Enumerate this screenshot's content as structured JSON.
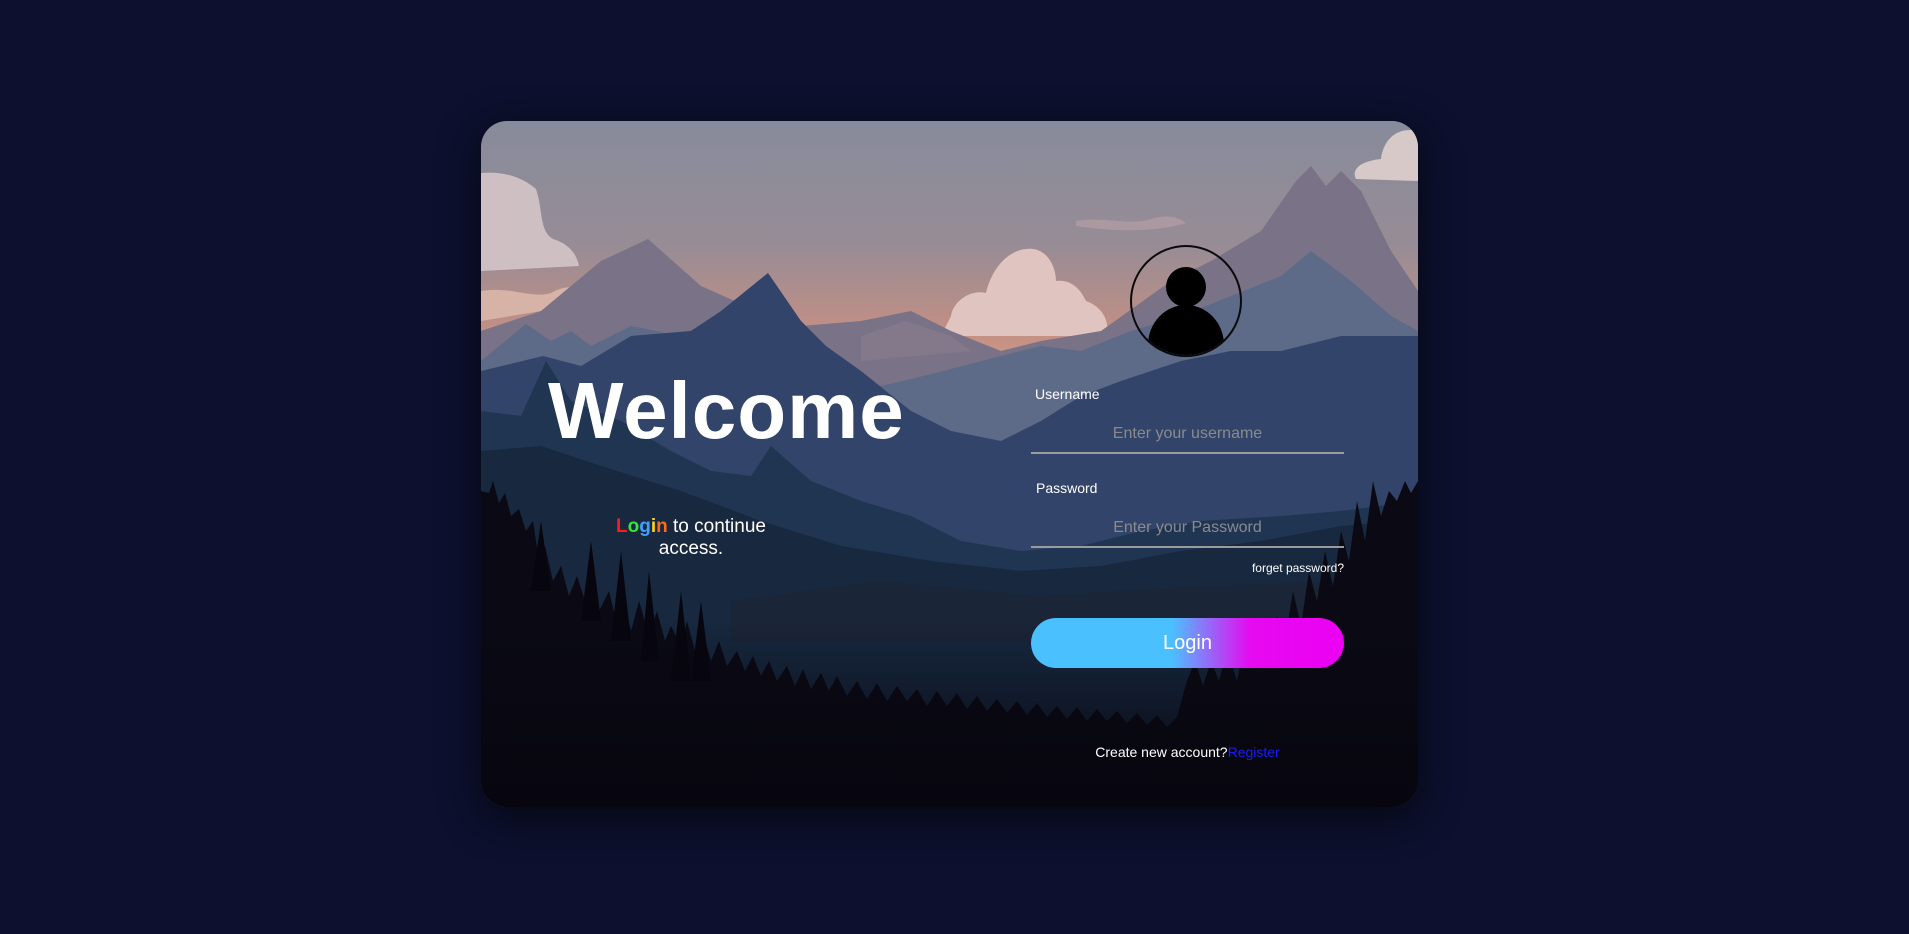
{
  "hero": {
    "title": "Welcome",
    "tagline_word": [
      "L",
      "o",
      "g",
      "i",
      "n"
    ],
    "tagline_rest": " to continue access."
  },
  "form": {
    "username_label": "Username",
    "username_placeholder": "Enter your username",
    "password_label": "Password",
    "password_placeholder": "Enter your Password",
    "forgot_text": "forget password?",
    "login_label": "Login",
    "create_text": "Create new account?",
    "register_text": "Register"
  },
  "colors": {
    "page_bg": "#0d102e",
    "button_start": "#4bc0ff",
    "button_end": "#ec00f3",
    "register_link": "#1a1aff",
    "tagline_letters": [
      "#ff1a1a",
      "#35e43a",
      "#3ea0ff",
      "#ffd21a",
      "#ff6a1a"
    ]
  },
  "icons": {
    "avatar": "user-avatar-icon"
  }
}
